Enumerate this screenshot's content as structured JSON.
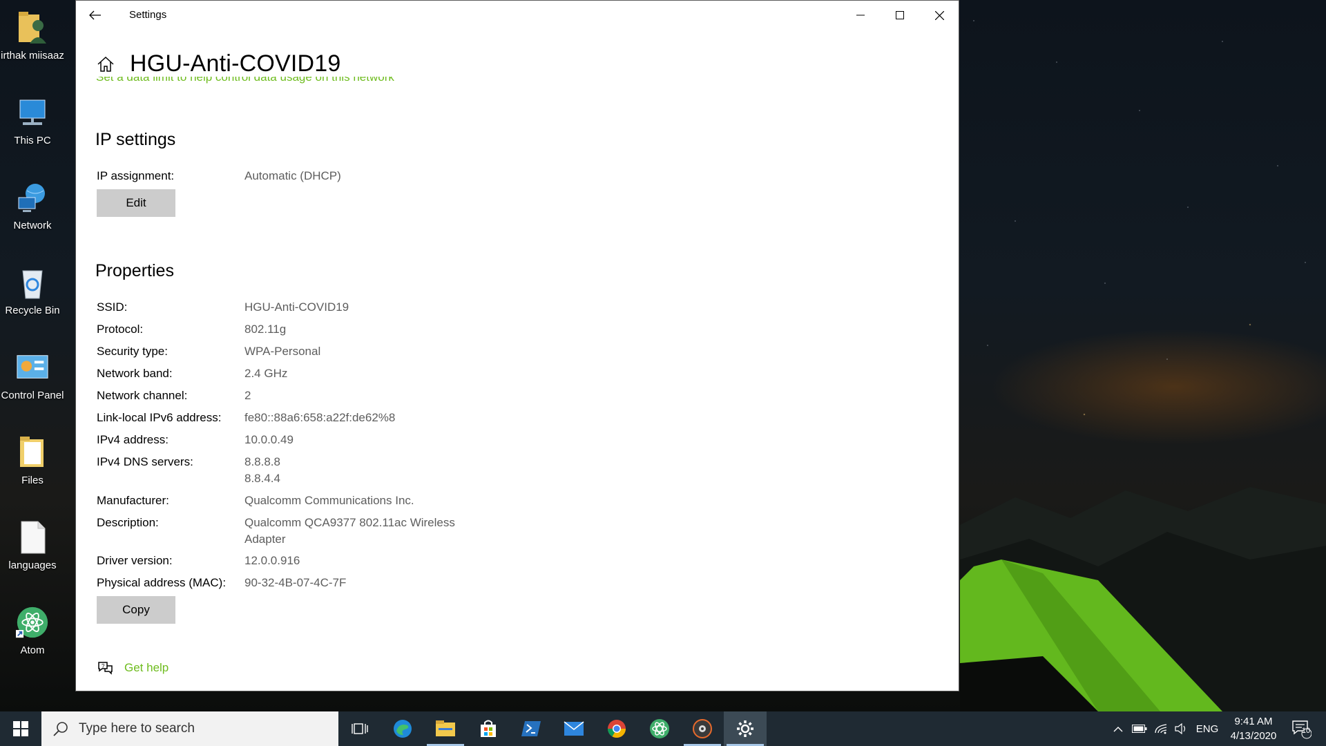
{
  "desktop": {
    "icons": [
      {
        "label": "irthak miisaaz",
        "icon": "user-folder-icon"
      },
      {
        "label": "This PC",
        "icon": "computer-icon"
      },
      {
        "label": "Network",
        "icon": "network-icon"
      },
      {
        "label": "Recycle Bin",
        "icon": "recycle-bin-icon"
      },
      {
        "label": "Control Panel",
        "icon": "control-panel-icon"
      },
      {
        "label": "Files",
        "icon": "folder-icon"
      },
      {
        "label": "languages",
        "icon": "document-icon"
      },
      {
        "label": "Atom",
        "icon": "atom-icon"
      }
    ]
  },
  "window": {
    "app_title": "Settings",
    "page_title": "HGU-Anti-COVID19",
    "data_limit_link": "Set a data limit to help control data usage on this network",
    "accent_color": "#6ebc1e",
    "ip_settings": {
      "title": "IP settings",
      "assignment_label": "IP assignment:",
      "assignment_value": "Automatic (DHCP)",
      "edit_label": "Edit"
    },
    "properties": {
      "title": "Properties",
      "rows": [
        {
          "label": "SSID:",
          "value": "HGU-Anti-COVID19"
        },
        {
          "label": "Protocol:",
          "value": "802.11g"
        },
        {
          "label": "Security type:",
          "value": "WPA-Personal"
        },
        {
          "label": "Network band:",
          "value": "2.4 GHz"
        },
        {
          "label": "Network channel:",
          "value": "2"
        },
        {
          "label": "Link-local IPv6 address:",
          "value": "fe80::88a6:658:a22f:de62%8"
        },
        {
          "label": "IPv4 address:",
          "value": "10.0.0.49"
        },
        {
          "label": "IPv4 DNS servers:",
          "value": "8.8.8.8",
          "value2": "8.8.4.4"
        },
        {
          "label": "Manufacturer:",
          "value": "Qualcomm Communications Inc."
        },
        {
          "label": "Description:",
          "value": "Qualcomm QCA9377 802.11ac Wireless",
          "value2": "Adapter"
        },
        {
          "label": "Driver version:",
          "value": "12.0.0.916"
        },
        {
          "label": "Physical address (MAC):",
          "value": "90-32-4B-07-4C-7F"
        }
      ],
      "copy_label": "Copy"
    },
    "help_label": "Get help"
  },
  "taskbar": {
    "search_placeholder": "Type here to search",
    "apps": [
      "task-view-icon",
      "edge-icon",
      "file-explorer-icon",
      "store-icon",
      "powershell-icon",
      "mail-icon",
      "chrome-icon",
      "atom-icon",
      "media-player-icon",
      "settings-icon"
    ],
    "language": "ENG",
    "time": "9:41 AM",
    "date": "4/13/2020",
    "notification_count": "10"
  }
}
